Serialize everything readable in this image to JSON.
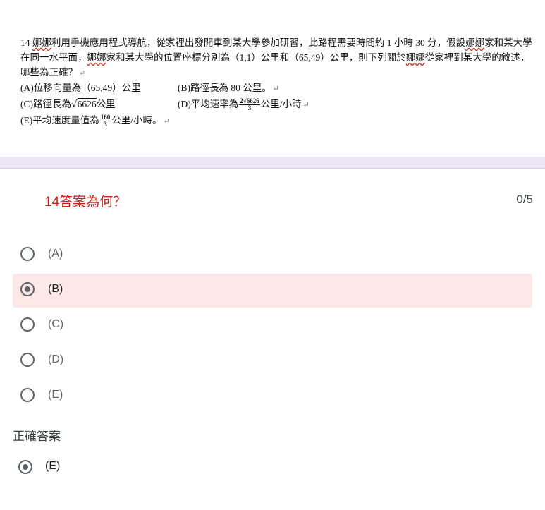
{
  "question_image": {
    "text_parts": [
      "14 ",
      "娜娜",
      "利用手機應用程式導航，從家裡出發開車到某大學參加研習，此路程需要時間約 1 小時 30 分，假設",
      "娜娜",
      "家和某大學在同一水平面，",
      "娜娜",
      "家和某大學的位置座標分別為（1,1）公里和（65,49）公里，則下列關於",
      "娜娜",
      "從家裡到某大學的敘述，哪些為正確？"
    ],
    "return_mark": "↵",
    "option_a": "(A)位移向量為（65,49）公里",
    "option_b": "(B)路徑長為 80 公里。",
    "option_c_prefix": "(C)路徑長為",
    "option_c_sqrt": "6626",
    "option_c_suffix": "公里",
    "option_d_prefix": "(D)平均速率為",
    "option_d_frac_num": "2√6626",
    "option_d_frac_den": "3",
    "option_d_suffix": "公里/小時",
    "option_e_prefix": "(E)平均速度量值為",
    "option_e_frac_num": "160",
    "option_e_frac_den": "3",
    "option_e_suffix": "公里/小時。"
  },
  "question": {
    "title": "14答案為何？",
    "score": "0/5"
  },
  "choices": [
    {
      "label": "(A)",
      "selected": false
    },
    {
      "label": "(B)",
      "selected": true
    },
    {
      "label": "(C)",
      "selected": false
    },
    {
      "label": "(D)",
      "selected": false
    },
    {
      "label": "(E)",
      "selected": false
    }
  ],
  "correct": {
    "title": "正確答案",
    "answer": "(E)"
  },
  "colors": {
    "title_red": "#c5221f",
    "selected_bg": "#fce8e6",
    "divider": "#ebe7f6",
    "radio_gray": "#5f6368"
  }
}
